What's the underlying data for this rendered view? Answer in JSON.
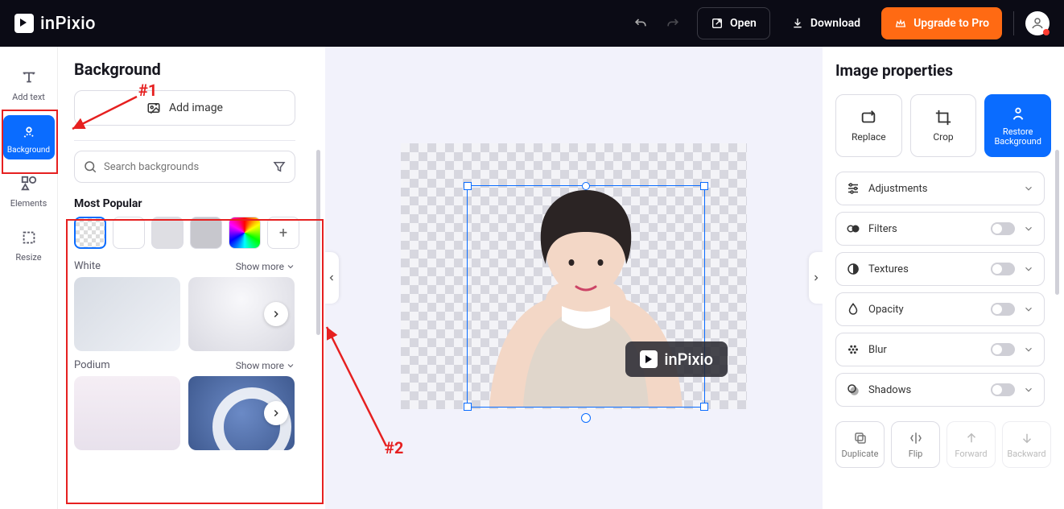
{
  "brand": {
    "name": "inPixio"
  },
  "topbar": {
    "open": "Open",
    "download": "Download",
    "upgrade": "Upgrade to Pro"
  },
  "rail": {
    "addText": "Add text",
    "background": "Background",
    "elements": "Elements",
    "resize": "Resize"
  },
  "panel": {
    "title": "Background",
    "addImage": "Add image",
    "searchPlaceholder": "Search backgrounds",
    "mostPopular": "Most Popular",
    "catWhite": "White",
    "catPodium": "Podium",
    "showMore": "Show more"
  },
  "watermark": {
    "text": "inPixio"
  },
  "props": {
    "title": "Image properties",
    "replace": "Replace",
    "crop": "Crop",
    "restore": "Restore",
    "restore2": "Background",
    "adjustments": "Adjustments",
    "filters": "Filters",
    "textures": "Textures",
    "opacity": "Opacity",
    "blur": "Blur",
    "shadows": "Shadows",
    "duplicate": "Duplicate",
    "flip": "Flip",
    "forward": "Forward",
    "backward": "Backward"
  },
  "annotations": {
    "a1": "#1",
    "a2": "#2"
  }
}
